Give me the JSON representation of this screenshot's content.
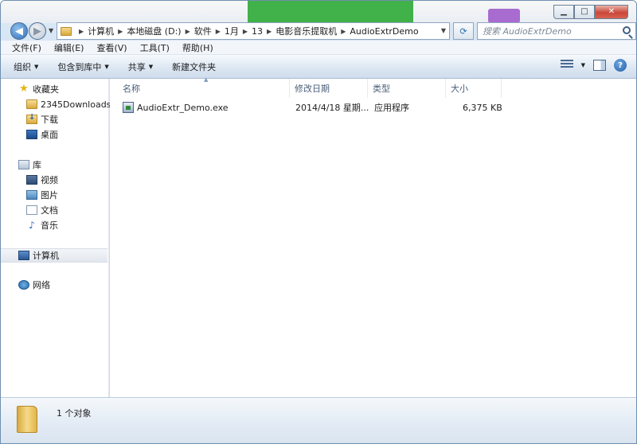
{
  "window": {
    "caption": {
      "minimize": "▁",
      "maximize": "□",
      "close": "✕"
    }
  },
  "nav": {
    "back_glyph": "◀",
    "forward_glyph": "▶",
    "breadcrumbs": [
      "计算机",
      "本地磁盘 (D:)",
      "软件",
      "1月",
      "13",
      "电影音乐提取机",
      "AudioExtrDemo"
    ],
    "refresh_glyph": "⟳",
    "search_placeholder": "搜索 AudioExtrDemo"
  },
  "menubar": [
    "文件(F)",
    "编辑(E)",
    "查看(V)",
    "工具(T)",
    "帮助(H)"
  ],
  "commandbar": {
    "organize": "组织",
    "include_library": "包含到库中",
    "share": "共享",
    "new_folder": "新建文件夹",
    "help": "?"
  },
  "navpane": {
    "favorites": "收藏夹",
    "fav_items": [
      "2345Downloads",
      "下载",
      "桌面"
    ],
    "libraries": "库",
    "lib_items": [
      "视频",
      "图片",
      "文档",
      "音乐"
    ],
    "computer": "计算机",
    "network": "网络"
  },
  "columns": {
    "name": "名称",
    "date": "修改日期",
    "type": "类型",
    "size": "大小"
  },
  "files": [
    {
      "name": "AudioExtr_Demo.exe",
      "date": "2014/4/18 星期...",
      "type": "应用程序",
      "size": "6,375 KB"
    }
  ],
  "details": {
    "count": "1 个对象"
  }
}
